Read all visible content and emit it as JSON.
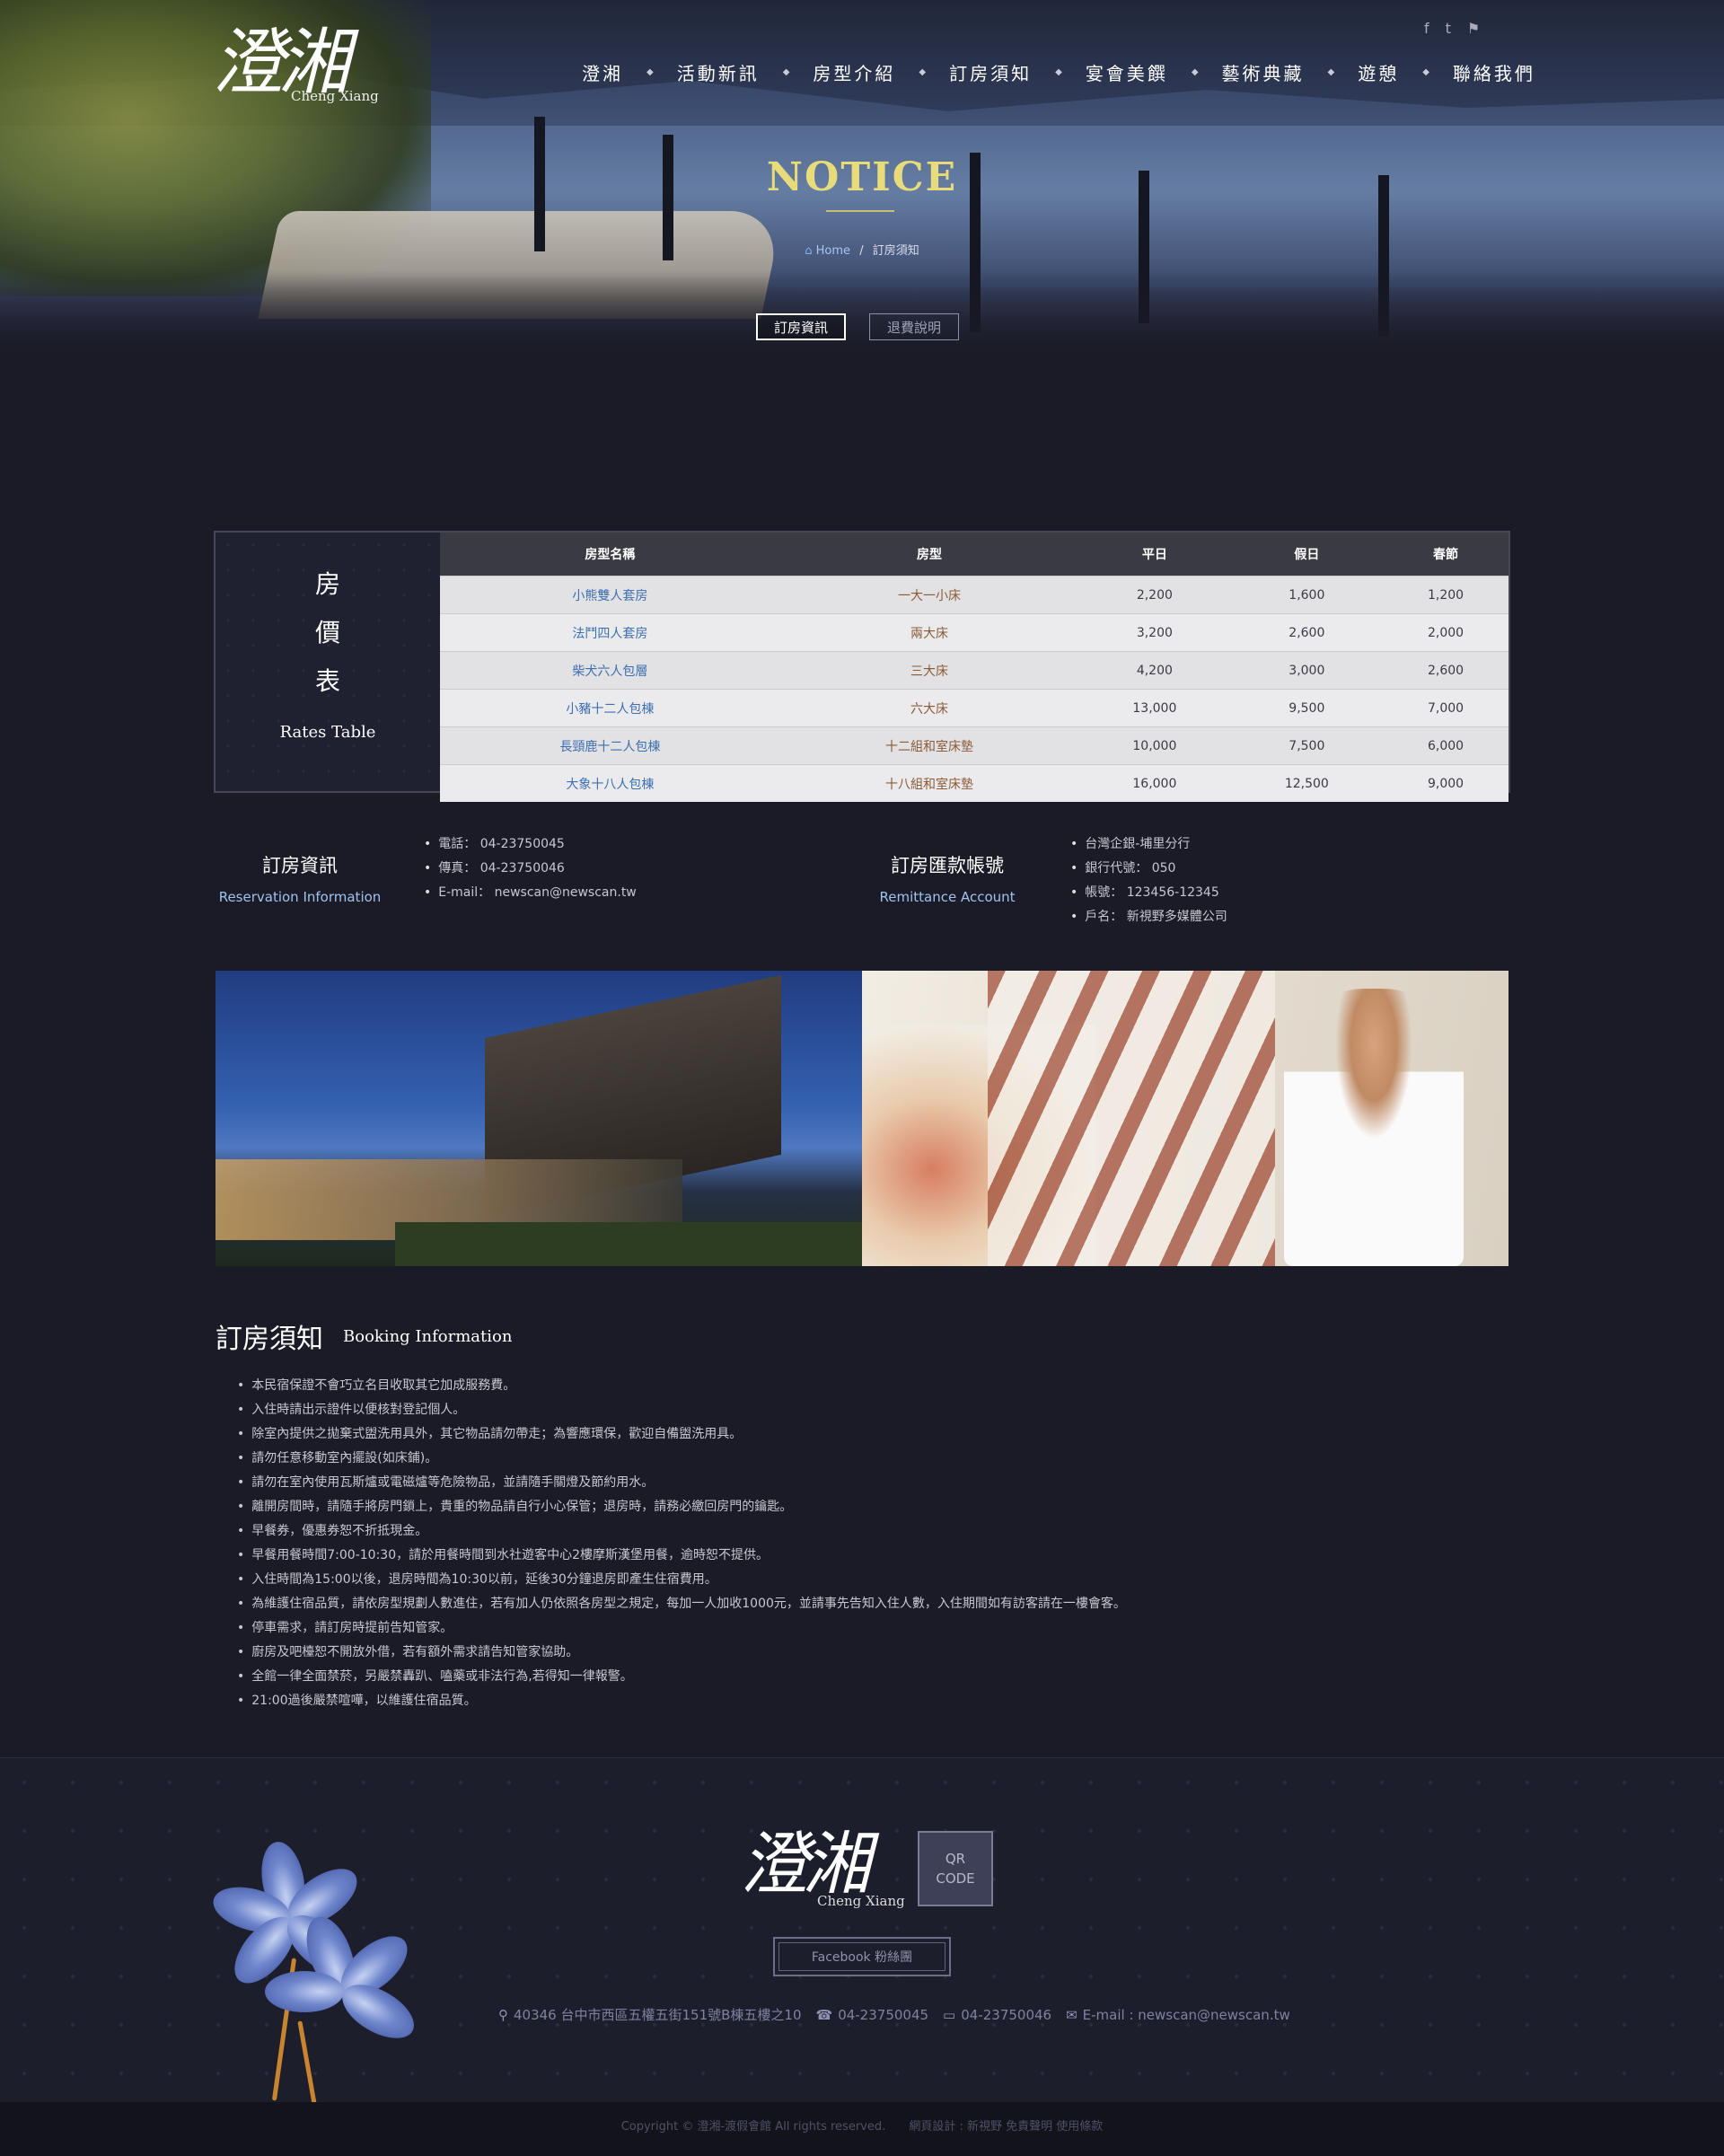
{
  "header": {
    "logo_cn": "澄湘",
    "logo_en": "Cheng Xiang",
    "social": [
      "f",
      "t",
      "⚑"
    ],
    "nav": [
      "澄湘",
      "活動新訊",
      "房型介紹",
      "訂房須知",
      "宴會美饌",
      "藝術典藏",
      "遊憩",
      "聯絡我們"
    ]
  },
  "hero": {
    "title": "NOTICE",
    "breadcrumb_home": "Home",
    "breadcrumb_sep": "/",
    "breadcrumb_current": "訂房須知",
    "tabs": [
      "訂房資訊",
      "退費說明"
    ]
  },
  "rates": {
    "side_chars": [
      "房",
      "價",
      "表"
    ],
    "side_en": "Rates Table",
    "headers": [
      "房型名稱",
      "房型",
      "平日",
      "假日",
      "春節"
    ],
    "rows": [
      [
        "小熊雙人套房",
        "一大一小床",
        "2,200",
        "1,600",
        "1,200"
      ],
      [
        "法鬥四人套房",
        "兩大床",
        "3,200",
        "2,600",
        "2,000"
      ],
      [
        "柴犬六人包層",
        "三大床",
        "4,200",
        "3,000",
        "2,600"
      ],
      [
        "小豬十二人包棟",
        "六大床",
        "13,000",
        "9,500",
        "7,000"
      ],
      [
        "長頸鹿十二人包棟",
        "十二組和室床墊",
        "10,000",
        "7,500",
        "6,000"
      ],
      [
        "大象十八人包棟",
        "十八組和室床墊",
        "16,000",
        "12,500",
        "9,000"
      ]
    ]
  },
  "reservation": {
    "title": "訂房資訊",
    "subtitle": "Reservation Information",
    "items": [
      "電話： 04-23750045",
      "傳真： 04-23750046",
      "E-mail： newscan@newscan.tw"
    ]
  },
  "remittance": {
    "title": "訂房匯款帳號",
    "subtitle": "Remittance Account",
    "items": [
      "台灣企銀-埔里分行",
      "銀行代號： 050",
      "帳號： 123456-12345",
      "戶名： 新視野多媒體公司"
    ]
  },
  "booking": {
    "title": "訂房須知",
    "subtitle": "Booking Information",
    "items": [
      "本民宿保證不會巧立名目收取其它加成服務費。",
      "入住時請出示證件以便核對登記個人。",
      "除室內提供之拋棄式盥洗用具外，其它物品請勿帶走；為響應環保，歡迎自備盥洗用具。",
      "請勿任意移動室內擺設(如床鋪)。",
      "請勿在室內使用瓦斯爐或電磁爐等危險物品，並請隨手關燈及節約用水。",
      "離開房間時，請隨手將房門鎖上，貴重的物品請自行小心保管；退房時，請務必繳回房門的鑰匙。",
      "早餐券，優惠券恕不折抵現金。",
      "早餐用餐時間7:00-10:30，請於用餐時間到水社遊客中心2樓摩斯漢堡用餐，逾時恕不提供。",
      "入住時間為15:00以後，退房時間為10:30以前，延後30分鐘退房即產生住宿費用。",
      "為維護住宿品質，請依房型規劃人數進住，若有加人仍依照各房型之規定，每加一人加收1000元，並請事先告知入住人數，入住期間如有訪客請在一樓會客。",
      "停車需求，請訂房時提前告知管家。",
      "廚房及吧檯恕不開放外借，若有額外需求請告知管家協助。",
      "全館一律全面禁菸，另嚴禁轟趴、嗑藥或非法行為,若得知一律報警。",
      "21:00過後嚴禁喧嘩，以維護住宿品質。"
    ]
  },
  "footer": {
    "logo_cn": "澄湘",
    "logo_en": "Cheng Xiang",
    "qr_line1": "QR",
    "qr_line2": "CODE",
    "facebook": "Facebook 粉絲團",
    "address": "40346 台中市西區五權五街151號B棟五樓之10",
    "phone": "04-23750045",
    "fax": "04-23750046",
    "email": "E-mail : newscan@newscan.tw",
    "copyright": "Copyright © 澄湘-渡假會館 All rights reserved.",
    "credits": "網頁設計 : 新視野   免責聲明  使用條款"
  }
}
